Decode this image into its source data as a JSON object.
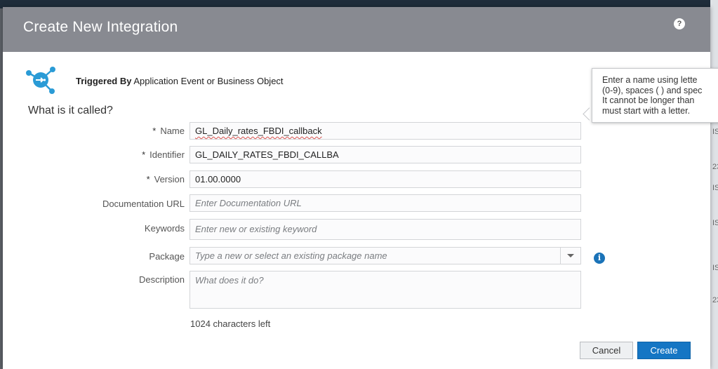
{
  "dialog": {
    "title": "Create New Integration",
    "help_icon": "?",
    "trigger_label": "Triggered By",
    "trigger_value": "Application Event or Business Object",
    "section_title": "What is it called?"
  },
  "form": {
    "name": {
      "label": "Name",
      "required": "*",
      "value": "GL_Daily_rates_FBDI_callback"
    },
    "identifier": {
      "label": "Identifier",
      "required": "*",
      "value": "GL_DAILY_RATES_FBDI_CALLBA"
    },
    "version": {
      "label": "Version",
      "required": "*",
      "value": "01.00.0000"
    },
    "documentation_url": {
      "label": "Documentation URL",
      "placeholder": "Enter Documentation URL"
    },
    "keywords": {
      "label": "Keywords",
      "placeholder": "Enter new or existing keyword"
    },
    "package": {
      "label": "Package",
      "placeholder": "Type a new or select an existing package name"
    },
    "description": {
      "label": "Description",
      "placeholder": "What does it do?",
      "chars_left": "1024 characters left"
    }
  },
  "buttons": {
    "cancel": "Cancel",
    "create": "Create"
  },
  "tooltip": {
    "lines": [
      "Enter a name using lette",
      "(0-9), spaces ( ) and spec",
      "It cannot be longer than",
      "must start with a letter."
    ]
  },
  "info_icon": "i",
  "background_fragments": [
    "IS",
    "23",
    "IS",
    "IS",
    "IS",
    "23"
  ],
  "colors": {
    "header": "#888a91",
    "accent": "#1576c4",
    "trigger_icon": "#2a9bd6"
  }
}
